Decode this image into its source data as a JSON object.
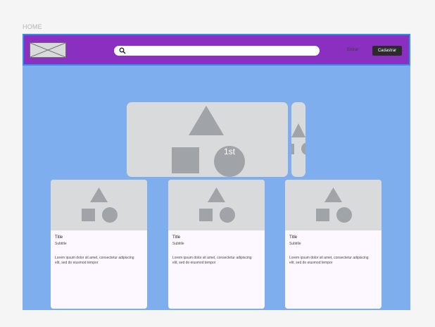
{
  "page": {
    "frame_label": "HOME"
  },
  "navbar": {
    "logo": "image-placeholder",
    "search": {
      "icon": "search-icon",
      "value": "",
      "placeholder": ""
    },
    "enter_label": "Entrar",
    "signup_label": "Cadastrar"
  },
  "carousel": {
    "slides": [
      {
        "badge": "1st"
      }
    ]
  },
  "cards": [
    {
      "title": "Title",
      "subtitle": "Subtitle",
      "body": "Lorem ipsum dolor sit amet, consectetur adipiscing elit, sed do eiusmod tempor"
    },
    {
      "title": "Title",
      "subtitle": "Subtitle",
      "body": "Lorem ipsum dolor sit amet, consectetur adipiscing elit, sed do eiusmod tempor"
    },
    {
      "title": "Title",
      "subtitle": "Subtitle",
      "body": "Lorem ipsum dolor sit amet, consectetur adipiscing elit, sed do eiusmod tempor"
    }
  ],
  "colors": {
    "page_background": "#f5f5f5",
    "frame_background": "#7faeee",
    "navbar_background": "#8b2fc0",
    "navbar_border": "#2d8fea",
    "placeholder": "#d9dadc",
    "shape": "#a0a3a8",
    "button_background": "#2b2b2b",
    "card_background": "#fdf8ff"
  }
}
